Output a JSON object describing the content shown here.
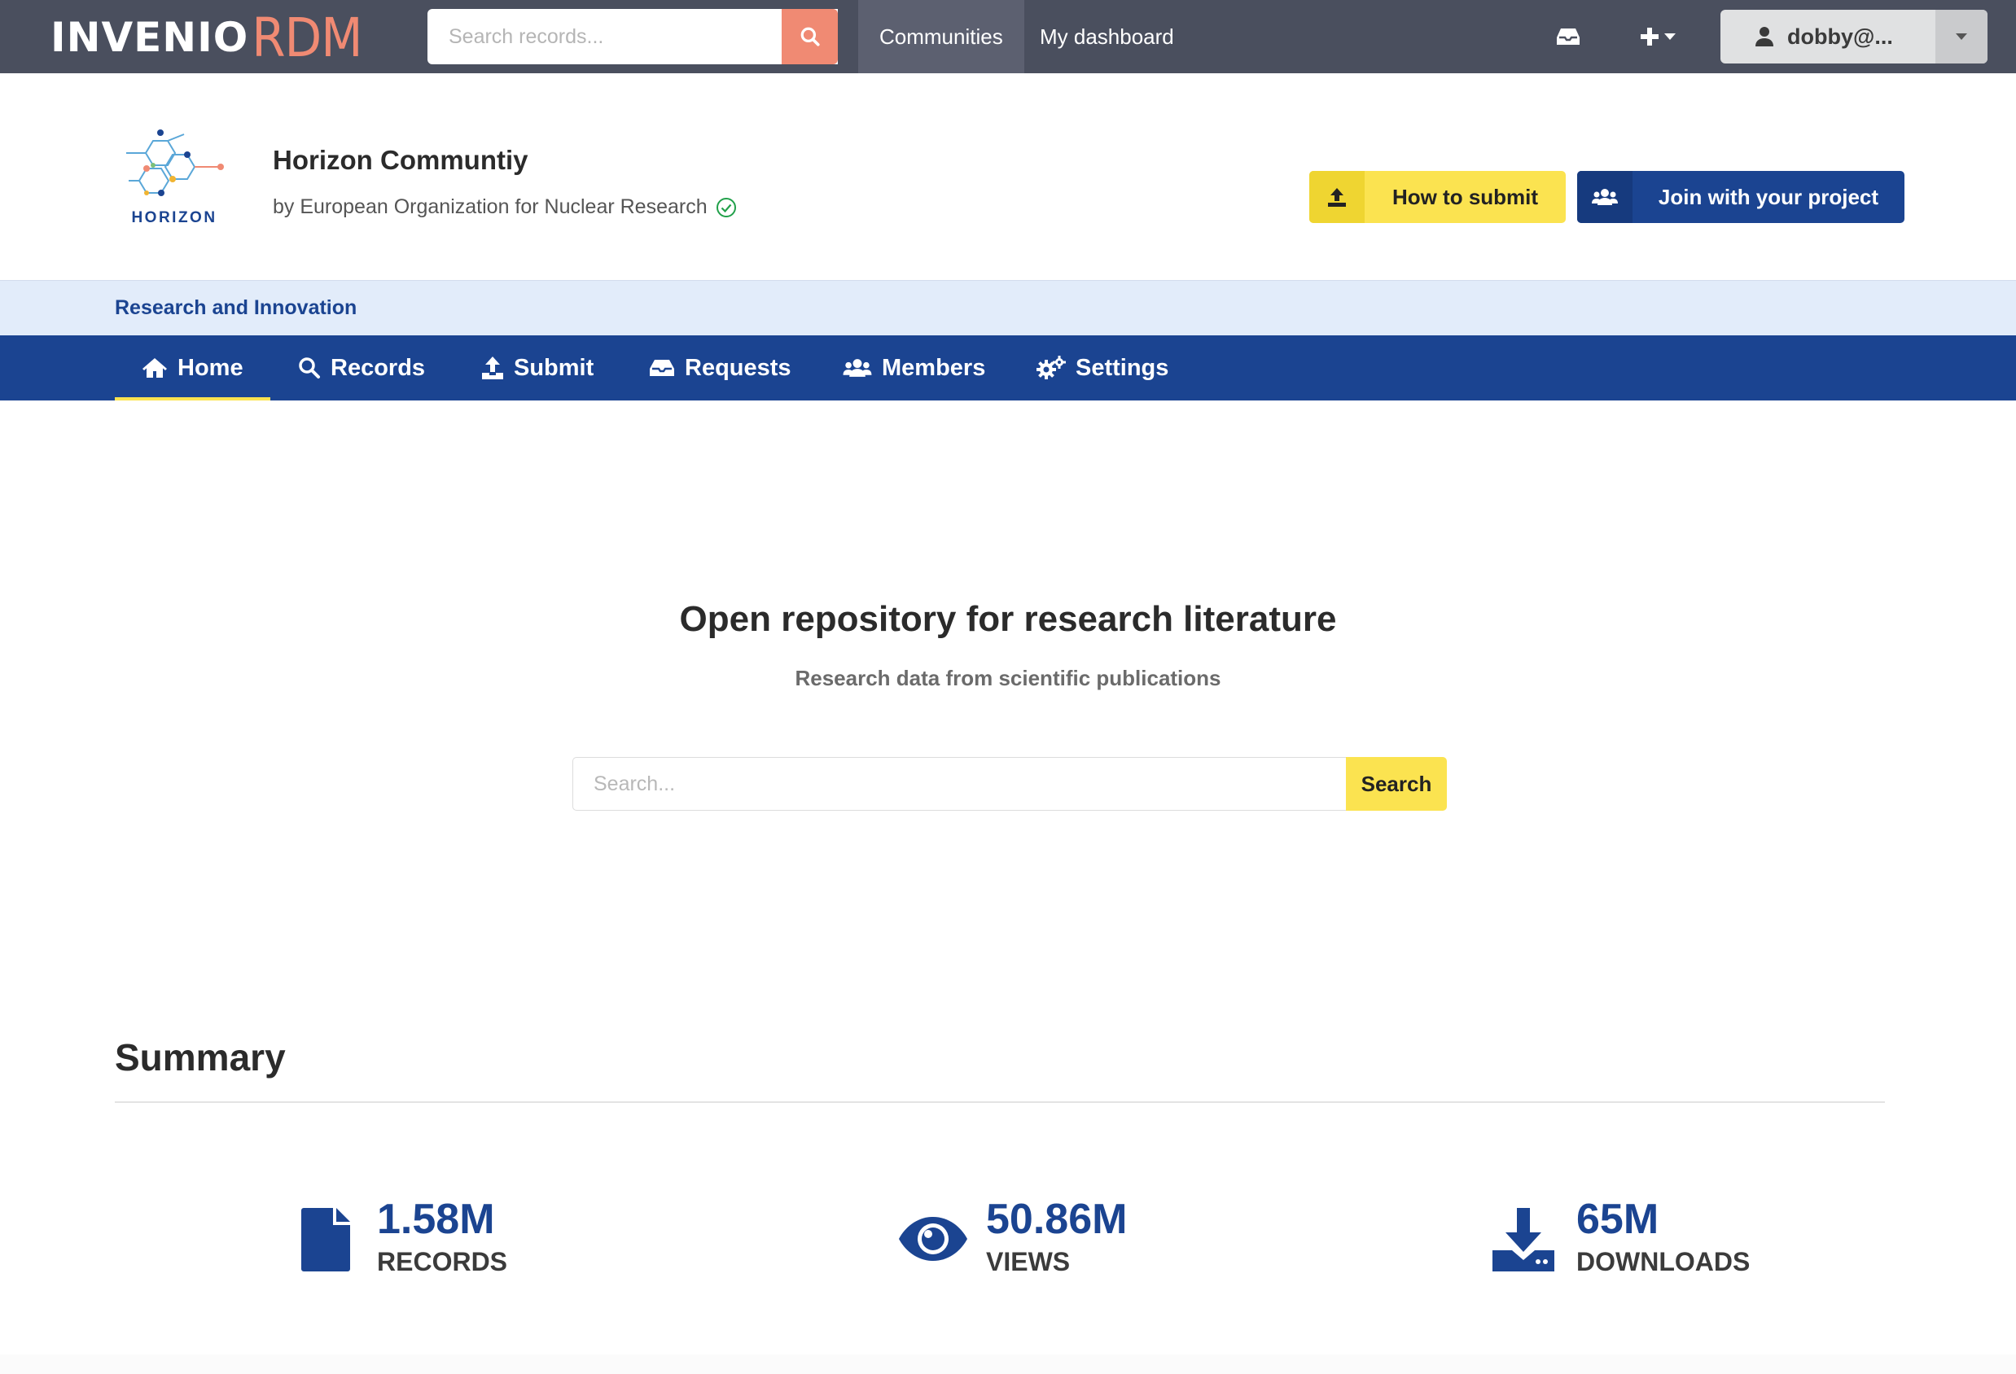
{
  "colors": {
    "navbar": "#4a4f5e",
    "brand_accent": "#f08a73",
    "primary_blue": "#1b4491",
    "yellow": "#fbe350",
    "strip_bg": "#e2ecfa"
  },
  "topbar": {
    "logo_part1": "INVENIO",
    "logo_part2": "RDM",
    "search_placeholder": "Search records...",
    "search_icon": "search-icon",
    "nav": [
      {
        "label": "Communities",
        "active": true
      },
      {
        "label": "My dashboard",
        "active": false
      }
    ],
    "inbox_icon": "inbox-icon",
    "plus_icon": "plus-icon",
    "user": {
      "icon": "user-icon",
      "label": "dobby@..."
    }
  },
  "community": {
    "logo_text": "HORIZON",
    "title": "Horizon Communtiy",
    "byline": "by European Organization for Nuclear Research",
    "verified_icon": "check-circle-icon",
    "how_to_submit": "How to submit",
    "join": "Join with your project"
  },
  "strip": {
    "label": "Research and Innovation"
  },
  "tabs": [
    {
      "label": "Home",
      "icon": "home-icon",
      "active": true
    },
    {
      "label": "Records",
      "icon": "search-icon"
    },
    {
      "label": "Submit",
      "icon": "upload-icon"
    },
    {
      "label": "Requests",
      "icon": "inbox-icon"
    },
    {
      "label": "Members",
      "icon": "users-icon"
    },
    {
      "label": "Settings",
      "icon": "cogs-icon"
    }
  ],
  "hero": {
    "title": "Open repository for research literature",
    "subtitle": "Research data from scientific publications",
    "search_placeholder": "Search...",
    "search_button": "Search"
  },
  "summary": {
    "title": "Summary",
    "stats": [
      {
        "value": "1.58M",
        "label": "RECORDS",
        "icon": "file-icon"
      },
      {
        "value": "50.86M",
        "label": "VIEWS",
        "icon": "eye-icon"
      },
      {
        "value": "65M",
        "label": "DOWNLOADS",
        "icon": "download-icon"
      }
    ]
  }
}
